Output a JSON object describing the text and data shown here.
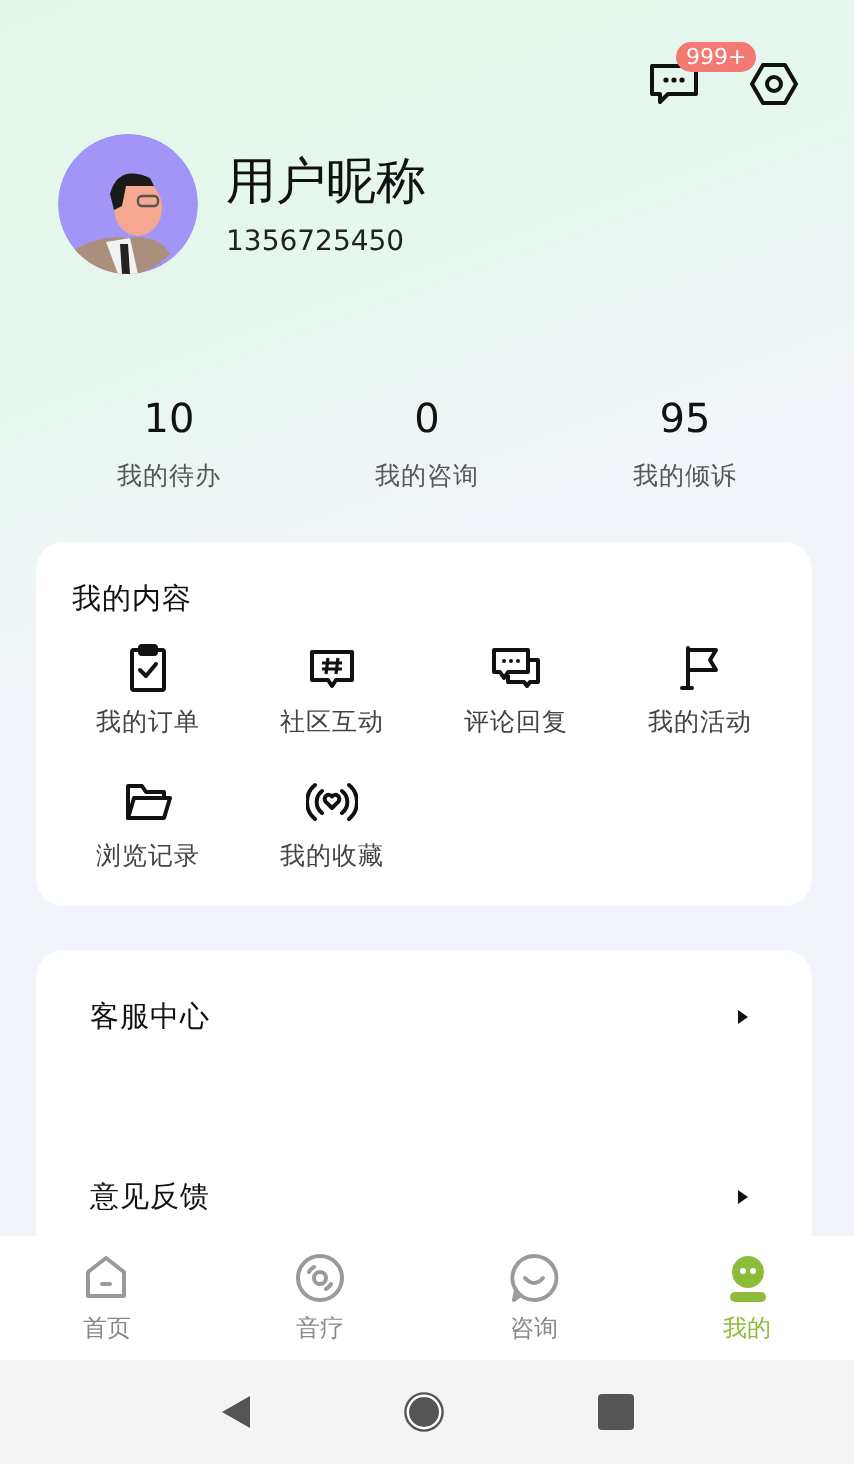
{
  "header": {
    "message_badge": "999+"
  },
  "profile": {
    "nickname": "用户昵称",
    "phone": "1356725450"
  },
  "stats": [
    {
      "value": "10",
      "label": "我的待办"
    },
    {
      "value": "0",
      "label": "我的咨询"
    },
    {
      "value": "95",
      "label": "我的倾诉"
    }
  ],
  "my_content": {
    "title": "我的内容",
    "items": [
      {
        "kind": "order",
        "label": "我的订单"
      },
      {
        "kind": "community",
        "label": "社区互动"
      },
      {
        "kind": "comment",
        "label": "评论回复"
      },
      {
        "kind": "activity",
        "label": "我的活动"
      },
      {
        "kind": "history",
        "label": "浏览记录"
      },
      {
        "kind": "favorite",
        "label": "我的收藏"
      }
    ]
  },
  "service_list": [
    {
      "label": "客服中心"
    },
    {
      "label": "意见反馈"
    }
  ],
  "tabs": [
    {
      "kind": "home",
      "label": "首页",
      "selected": false
    },
    {
      "kind": "music",
      "label": "音疗",
      "selected": false
    },
    {
      "kind": "consult",
      "label": "咨询",
      "selected": false
    },
    {
      "kind": "mine",
      "label": "我的",
      "selected": true
    }
  ]
}
